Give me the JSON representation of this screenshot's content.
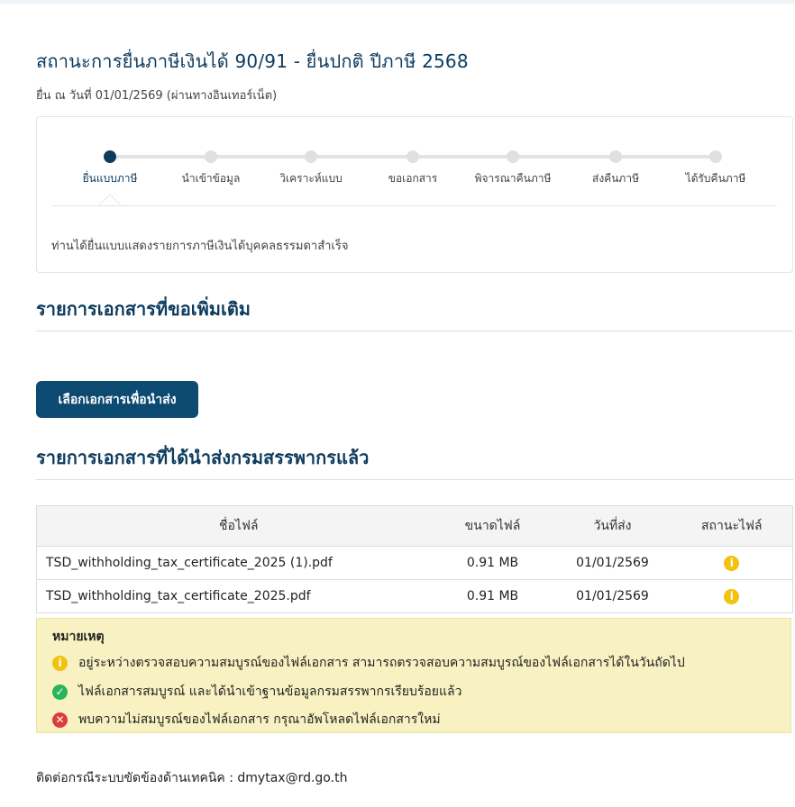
{
  "page": {
    "title": "สถานะการยื่นภาษีเงินได้ 90/91 - ยื่นปกติ ปีภาษี 2568",
    "subtitle": "ยื่น ณ วันที่ 01/01/2569 (ผ่านทางอินเทอร์เน็ต)"
  },
  "stepper": {
    "steps": [
      {
        "label": "ยื่นแบบภาษี",
        "active": true
      },
      {
        "label": "นำเข้าข้อมูล",
        "active": false
      },
      {
        "label": "วิเคราะห์แบบ",
        "active": false
      },
      {
        "label": "ขอเอกสาร",
        "active": false
      },
      {
        "label": "พิจารณาคืนภาษี",
        "active": false
      },
      {
        "label": "ส่งคืนภาษี",
        "active": false
      },
      {
        "label": "ได้รับคืนภาษี",
        "active": false
      }
    ],
    "message": "ท่านได้ยื่นแบบแสดงรายการภาษีเงินได้บุคคลธรรมดาสำเร็จ"
  },
  "requested_docs": {
    "title": "รายการเอกสารที่ขอเพิ่มเติม",
    "button_label": "เลือกเอกสารเพื่อนำส่ง"
  },
  "submitted_docs": {
    "title": "รายการเอกสารที่ได้นำส่งกรมสรรพากรแล้ว",
    "columns": [
      "ชื่อไฟล์",
      "ขนาดไฟล์",
      "วันที่ส่ง",
      "สถานะไฟล์"
    ],
    "rows": [
      {
        "name": "TSD_withholding_tax_certificate_2025 (1).pdf",
        "size": "0.91 MB",
        "date": "01/01/2569",
        "status_icon": "info-icon"
      },
      {
        "name": "TSD_withholding_tax_certificate_2025.pdf",
        "size": "0.91 MB",
        "date": "01/01/2569",
        "status_icon": "info-icon"
      }
    ]
  },
  "notes": {
    "title": "หมายเหตุ",
    "items": [
      {
        "icon": "info-icon",
        "color": "#f2c20c",
        "text": "อยู่ระหว่างตรวจสอบความสมบูรณ์ของไฟล์เอกสาร สามารถตรวจสอบความสมบูรณ์ของไฟล์เอกสารได้ในวันถัดไป"
      },
      {
        "icon": "check-icon",
        "color": "#28b55a",
        "text": "ไฟล์เอกสารสมบูรณ์ และได้นำเข้าฐานข้อมูลกรมสรรพากรเรียบร้อยแล้ว"
      },
      {
        "icon": "error-icon",
        "color": "#dc3b3b",
        "text": "พบความไม่สมบูรณ์ของไฟล์เอกสาร กรุณาอัพโหลดไฟล์เอกสารใหม่"
      }
    ]
  },
  "contact": "ติดต่อกรณีระบบขัดข้องด้านเทคนิค : dmytax@rd.go.th",
  "colors": {
    "primary": "#0d3b5e",
    "button": "#0d4a72",
    "note_bg": "#f8f2c2"
  }
}
